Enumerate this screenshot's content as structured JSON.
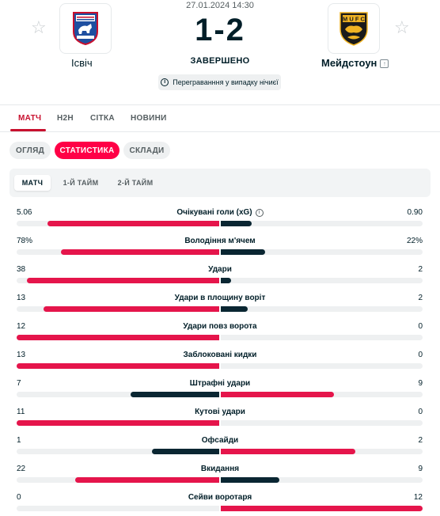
{
  "match": {
    "datetime": "27.01.2024 14:30",
    "score": "1-2",
    "status": "ЗАВЕРШЕНО",
    "replay_note": "Переграванння у випадку нічиєї",
    "home_team": "Ісвіч",
    "away_team": "Мейдстоун",
    "home_logo_text": "IPSWICH TOWN",
    "away_logo_text": "MUFC"
  },
  "nav_tabs": [
    "МАТЧ",
    "H2H",
    "СІТКА",
    "НОВИНИ"
  ],
  "sub_tabs": [
    "ОГЛЯД",
    "СТАТИСТИКА",
    "СКЛАДИ"
  ],
  "period_tabs": [
    "МАТЧ",
    "1-Й ТАЙМ",
    "2-Й ТАЙМ"
  ],
  "colors": {
    "accent": "#ff0046",
    "home_bar": "#e5154b",
    "away_bar_low": "#0a2632",
    "away_bar_high": "#e5154b",
    "track": "#eef0f1"
  },
  "stats": [
    {
      "name": "Очікувані голи (xG)",
      "home": "5.06",
      "away": "0.90",
      "home_share": 0.849,
      "away_share": 0.151,
      "info": true
    },
    {
      "name": "Володіння м'ячем",
      "home": "78%",
      "away": "22%",
      "home_share": 0.78,
      "away_share": 0.22,
      "info": false
    },
    {
      "name": "Удари",
      "home": "38",
      "away": "2",
      "home_share": 0.95,
      "away_share": 0.05,
      "info": false
    },
    {
      "name": "Удари в площину воріт",
      "home": "13",
      "away": "2",
      "home_share": 0.867,
      "away_share": 0.133,
      "info": false
    },
    {
      "name": "Удари повз ворота",
      "home": "12",
      "away": "0",
      "home_share": 1.0,
      "away_share": 0.0,
      "info": false
    },
    {
      "name": "Заблоковані кидки",
      "home": "13",
      "away": "0",
      "home_share": 1.0,
      "away_share": 0.0,
      "info": false
    },
    {
      "name": "Штрафні удари",
      "home": "7",
      "away": "9",
      "home_share": 0.4375,
      "away_share": 0.5625,
      "info": false
    },
    {
      "name": "Кутові удари",
      "home": "11",
      "away": "0",
      "home_share": 1.0,
      "away_share": 0.0,
      "info": false
    },
    {
      "name": "Офсайди",
      "home": "1",
      "away": "2",
      "home_share": 0.333,
      "away_share": 0.667,
      "info": false
    },
    {
      "name": "Вкидання",
      "home": "22",
      "away": "9",
      "home_share": 0.71,
      "away_share": 0.29,
      "info": false
    },
    {
      "name": "Сейви воротаря",
      "home": "0",
      "away": "12",
      "home_share": 0.0,
      "away_share": 1.0,
      "info": false
    }
  ]
}
